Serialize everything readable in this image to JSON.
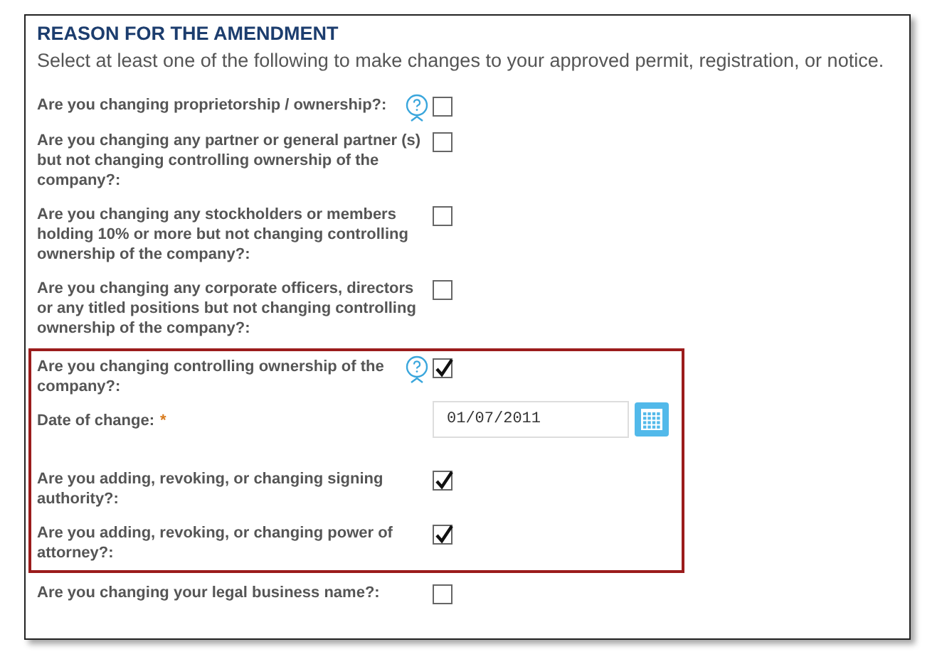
{
  "section": {
    "title": "REASON FOR THE AMENDMENT",
    "instructions": "Select at least one of the following to make changes to your approved permit, registration, or notice."
  },
  "questions": [
    {
      "kind": "checkbox",
      "label": "Are you changing proprietorship / ownership?:",
      "help": true,
      "checked": false,
      "highlighted": false
    },
    {
      "kind": "checkbox",
      "label": "Are you changing any partner or general partner (s) but not changing controlling ownership of the company?:",
      "help": false,
      "checked": false,
      "highlighted": false
    },
    {
      "kind": "checkbox",
      "label": "Are you changing any stockholders or members holding 10% or more but not changing controlling ownership of the company?:",
      "help": false,
      "checked": false,
      "highlighted": false
    },
    {
      "kind": "checkbox",
      "label": "Are you changing any corporate officers, directors or any titled positions but not changing controlling ownership of the company?:",
      "help": false,
      "checked": false,
      "highlighted": false
    },
    {
      "kind": "checkbox",
      "label": "Are you changing controlling ownership of the company?:",
      "help": true,
      "checked": true,
      "highlighted": true
    },
    {
      "kind": "date",
      "label": "Date of change:",
      "required": true,
      "required_mark": "*",
      "value": "01/07/2011",
      "highlighted": true
    },
    {
      "kind": "checkbox",
      "label": "Are you adding, revoking, or changing signing authority?:",
      "help": false,
      "checked": true,
      "highlighted": true
    },
    {
      "kind": "checkbox",
      "label": "Are you adding, revoking, or changing power of attorney?:",
      "help": false,
      "checked": true,
      "highlighted": true
    },
    {
      "kind": "checkbox",
      "label": "Are you changing your legal business name?:",
      "help": false,
      "checked": false,
      "highlighted": false
    }
  ]
}
